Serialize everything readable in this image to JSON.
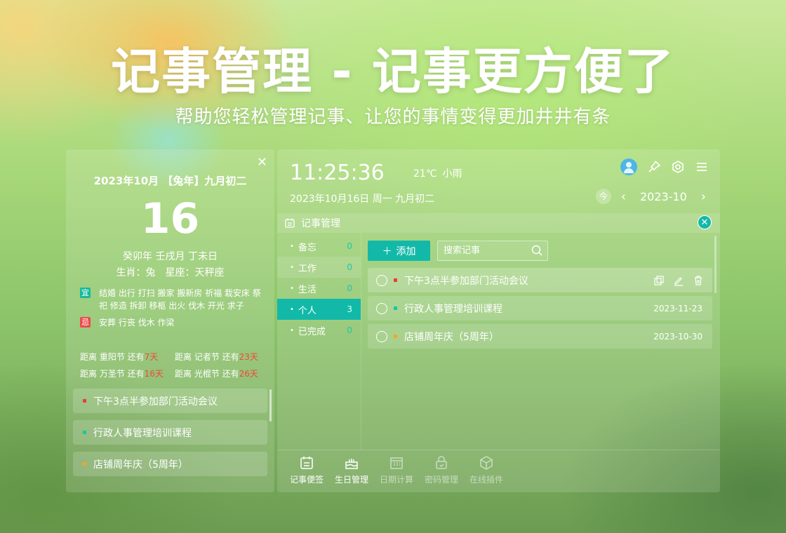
{
  "hero": {
    "title": "记事管理 - 记事更方便了",
    "subtitle": "帮助您轻松管理记事、让您的事情变得更加井井有条"
  },
  "left": {
    "close": "✕",
    "date_line": "2023年10月 【兔年】九月初二",
    "day": "16",
    "lunar": "癸卯年 壬戌月 丁未日",
    "zodiac": "生肖：兔",
    "constellation": "星座：天秤座",
    "yi_tag": "宜",
    "yi_text": "结婚 出行 打扫 搬家 搬新房 祈福 栽安床 祭祀 修造 拆卸 移柩 出火 伐木 开光 求子",
    "ji_tag": "忌",
    "ji_text": "安葬 行丧 伐木 作梁",
    "countdowns": [
      {
        "prefix": "距离 重阳节 还有",
        "days": "7天"
      },
      {
        "prefix": "距离 记者节 还有",
        "days": "23天"
      },
      {
        "prefix": "距离 万圣节 还有",
        "days": "16天"
      },
      {
        "prefix": "距离 光棍节 还有",
        "days": "26天"
      }
    ],
    "items": [
      {
        "text": "下午3点半参加部门活动会议",
        "color": "#ef3b3b"
      },
      {
        "text": "行政人事管理培训课程",
        "color": "#18c8a0"
      },
      {
        "text": "店铺周年庆（5周年）",
        "color": "#f5a623"
      }
    ]
  },
  "main": {
    "time": "11:25:36",
    "temperature": "21℃",
    "weather": "小雨",
    "date_line": "2023年10月16日 周一 九月初二",
    "today_label": "今",
    "month": "2023-10",
    "module_title": "记事管理",
    "categories": [
      {
        "label": "备忘",
        "count": "0"
      },
      {
        "label": "工作",
        "count": "0"
      },
      {
        "label": "生活",
        "count": "0"
      },
      {
        "label": "个人",
        "count": "3"
      },
      {
        "label": "已完成",
        "count": "0"
      }
    ],
    "add_label": "添加",
    "search_placeholder": "搜索记事",
    "notes": [
      {
        "text": "下午3点半参加部门活动会议",
        "date": "",
        "color": "#ef3b3b"
      },
      {
        "text": "行政人事管理培训课程",
        "date": "2023-11-23",
        "color": "#18c8a0"
      },
      {
        "text": "店铺周年庆（5周年）",
        "date": "2023-10-30",
        "color": "#f5a623"
      }
    ],
    "bottom_nav": [
      {
        "label": "记事便签",
        "icon": "notepad-icon"
      },
      {
        "label": "生日管理",
        "icon": "cake-icon"
      },
      {
        "label": "日期计算",
        "icon": "calendar-grid-icon"
      },
      {
        "label": "密码管理",
        "icon": "lock-icon"
      },
      {
        "label": "在线插件",
        "icon": "cube-icon"
      }
    ]
  }
}
